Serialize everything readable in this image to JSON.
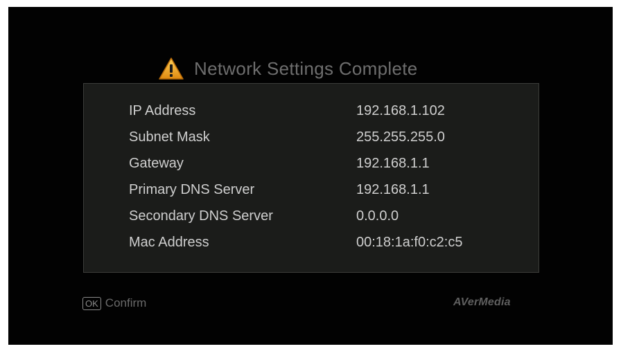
{
  "dialog": {
    "title": "Network Settings Complete",
    "icon": "warning-triangle-icon",
    "accent_color": "#f0a020"
  },
  "network_info": [
    {
      "label": "IP Address",
      "value": "192.168.1.102"
    },
    {
      "label": "Subnet Mask",
      "value": "255.255.255.0"
    },
    {
      "label": "Gateway",
      "value": "192.168.1.1"
    },
    {
      "label": "Primary DNS Server",
      "value": "192.168.1.1"
    },
    {
      "label": "Secondary DNS Server",
      "value": "0.0.0.0"
    },
    {
      "label": "Mac Address",
      "value": "00:18:1a:f0:c2:c5"
    }
  ],
  "footer": {
    "ok_key": "OK",
    "confirm_label": "Confirm",
    "brand": "AVerMedia"
  }
}
